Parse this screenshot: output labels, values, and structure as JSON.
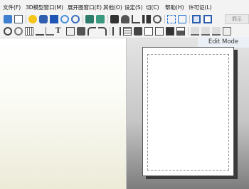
{
  "menu": [
    "文件(F)",
    "3D模型窗口(M)",
    "展开图窗口(E)",
    "其他(O)",
    "设定(S)",
    "切(C)",
    "帮助(H)",
    "许可证(L)"
  ],
  "toolbar": {
    "truncated_button_label": "罪示"
  },
  "toolbar1_icons": [
    "folder-open-icon",
    "save-icon",
    "lightbulb-icon",
    "paint-icon",
    "cube-icon",
    "sphere-icon",
    "rotate-icon",
    "paint-bucket-icon",
    "fill-icon",
    "brush-icon",
    "cylinder-icon",
    "person-icon",
    "bar-chart-icon",
    "link-icon",
    "select-area-icon",
    "resize-icon",
    "single-window-icon",
    "split-window-icon"
  ],
  "toolbar2_icons": [
    "rotate-view-icon",
    "orbit-icon",
    "grid-icon",
    "line-tool-icon",
    "pencil-icon",
    "text-icon",
    "image-icon",
    "stamp-icon",
    "undo-icon",
    "redo-icon",
    "align-icon",
    "distribute-icon",
    "move-icon",
    "page-icon",
    "sheet-icon",
    "layout-icon",
    "print-icon",
    "align-left-icon",
    "align-center-icon",
    "align-right-icon",
    "panel-icon"
  ],
  "edit_mode_label": "Edit Mode"
}
